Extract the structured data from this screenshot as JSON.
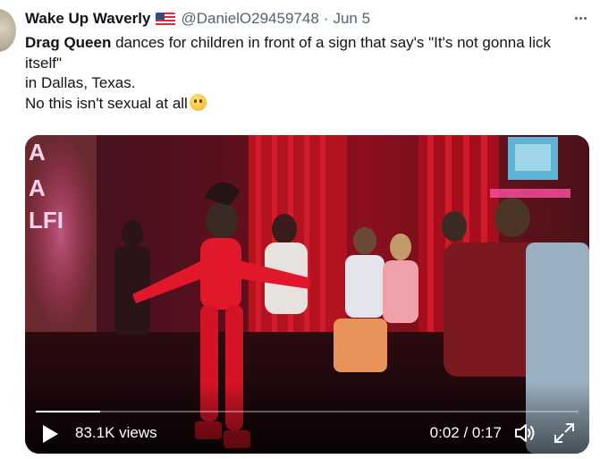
{
  "tweet": {
    "display_name": "Wake Up Waverly",
    "flag_icon": "us-flag-icon",
    "handle": "@DanielO29459748",
    "separator": "·",
    "date": "Jun 5",
    "text": {
      "line1_bold": "Drag Queen",
      "line1_rest": " dances for children in front of a sign that say's \"It's not gonna lick itself\"",
      "line2": "in Dallas, Texas.",
      "line3": "No this isn't sexual at all",
      "emoji": "thinking-face-icon"
    }
  },
  "video": {
    "views": "83.1K views",
    "time": "0:02 / 0:17",
    "progress_fraction": 0.118,
    "icons": {
      "play": "play-icon",
      "volume": "volume-icon",
      "fullscreen": "fullscreen-icon"
    }
  },
  "colors": {
    "text_primary": "#0f1419",
    "text_secondary": "#536471",
    "stage_red": "#c8142a",
    "neon_pink": "#ff4fa3"
  }
}
